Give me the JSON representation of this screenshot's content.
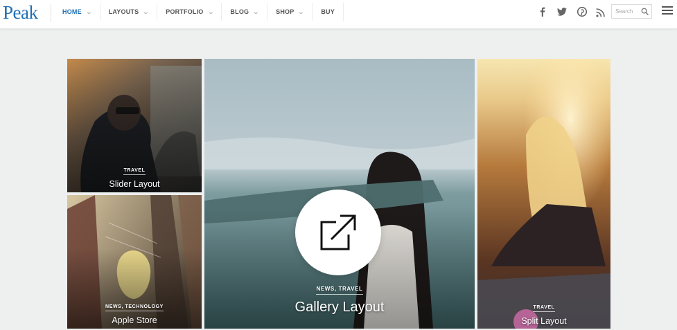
{
  "header": {
    "logo": "Peak",
    "nav": [
      {
        "label": "HOME",
        "active": true,
        "has_caret": true
      },
      {
        "label": "LAYOUTS",
        "active": false,
        "has_caret": true
      },
      {
        "label": "PORTFOLIO",
        "active": false,
        "has_caret": true
      },
      {
        "label": "BLOG",
        "active": false,
        "has_caret": true
      },
      {
        "label": "SHOP",
        "active": false,
        "has_caret": true
      },
      {
        "label": "BUY",
        "active": false,
        "has_caret": false
      }
    ],
    "social_icons": [
      "facebook-icon",
      "twitter-icon",
      "pinterest-icon",
      "rss-icon"
    ],
    "search": {
      "placeholder": "Search",
      "icon": "search-icon"
    },
    "menu_icon": "hamburger-menu-icon"
  },
  "posts": [
    {
      "category": "TRAVEL",
      "title": "Slider Layout"
    },
    {
      "category": "NEWS, TECHNOLOGY",
      "title": "Apple Store"
    },
    {
      "category": "NEWS, TRAVEL",
      "title": "Gallery Layout"
    },
    {
      "category": "TRAVEL",
      "title": "Split Layout"
    }
  ],
  "overlay": {
    "icon": "external-link-icon"
  },
  "colors": {
    "brand": "#1f6fb5",
    "background": "#eef0f0",
    "nav_text": "#555555"
  }
}
